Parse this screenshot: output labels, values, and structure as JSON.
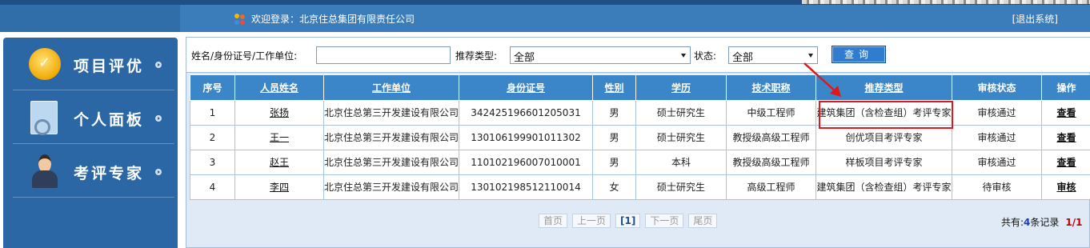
{
  "header": {
    "welcome": "欢迎登录：北京住总集团有限责任公司",
    "logout": "[退出系统]",
    "welcome_icon": "users-icon"
  },
  "sidebar": {
    "items": [
      {
        "label": "项目评优",
        "icon": "medal-icon"
      },
      {
        "label": "个人面板",
        "icon": "clipboard-icon"
      },
      {
        "label": "考评专家",
        "icon": "expert-icon"
      }
    ]
  },
  "search": {
    "name_label": "姓名/身份证号/工作单位:",
    "name_value": "",
    "type_label": "推荐类型:",
    "type_value": "全部",
    "status_label": "状态:",
    "status_value": "全部",
    "query_button": "查询"
  },
  "table": {
    "headers": [
      "序号",
      "人员姓名",
      "工作单位",
      "身份证号",
      "性别",
      "学历",
      "技术职称",
      "推荐类型",
      "审核状态",
      "操作"
    ],
    "rows": [
      {
        "no": "1",
        "name": "张扬",
        "unit": "北京住总第三开发建设有限公司",
        "id": "342425196601205031",
        "gender": "男",
        "edu": "硕士研究生",
        "title": "中级工程师",
        "type": "建筑集团（含检查组）考评专家",
        "status": "审核通过",
        "op": "查看"
      },
      {
        "no": "2",
        "name": "王一",
        "unit": "北京住总第三开发建设有限公司",
        "id": "130106199901011302",
        "gender": "男",
        "edu": "硕士研究生",
        "title": "教授级高级工程师",
        "type": "创优项目考评专家",
        "status": "审核通过",
        "op": "查看"
      },
      {
        "no": "3",
        "name": "赵王",
        "unit": "北京住总第三开发建设有限公司",
        "id": "110102196007010001",
        "gender": "男",
        "edu": "本科",
        "title": "教授级高级工程师",
        "type": "样板项目考评专家",
        "status": "审核通过",
        "op": "查看"
      },
      {
        "no": "4",
        "name": "李四",
        "unit": "北京住总第三开发建设有限公司",
        "id": "130102198512110014",
        "gender": "女",
        "edu": "硕士研究生",
        "title": "高级工程师",
        "type": "建筑集团（含检查组）考评专家",
        "status": "待审核",
        "op": "审核"
      }
    ]
  },
  "pager": {
    "first": "首页",
    "prev": "上一页",
    "current": "[1]",
    "next": "下一页",
    "last": "尾页",
    "total_prefix": "共有:",
    "total_count": "4",
    "total_suffix": "条记录",
    "pages": "1/1"
  },
  "colors": {
    "header_blue": "#2f6ea8",
    "table_header": "#3b86c8",
    "highlight_red": "#e01818"
  }
}
